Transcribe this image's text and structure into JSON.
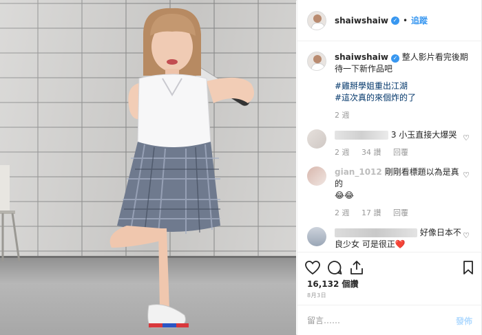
{
  "post": {
    "username": "shaiwshaiw",
    "follow_label": "追蹤",
    "separator": "•"
  },
  "caption": {
    "username": "shaiwshaiw",
    "text": "整人影片看完後期待一下新作品吧",
    "hashtags": [
      "#雞掰學姐重出江湖",
      "#這次真的來個炸的了"
    ],
    "time": "2 週"
  },
  "comments": [
    {
      "name_partial": "",
      "text": "3 小玉直接大爆哭",
      "time": "2 週",
      "likes": "34 讚",
      "reply_label": "回覆"
    },
    {
      "name_partial": "gian_1012",
      "text": "剛剛看標題以為是真的",
      "emoji": "😂😂",
      "time": "2 週",
      "likes": "17 讚",
      "reply_label": "回覆"
    },
    {
      "name_partial": "",
      "text": "好像日本不良少女 可是很正",
      "emoji": "❤️"
    }
  ],
  "engagement": {
    "likes": "16,132 個讚",
    "date": "8月3日"
  },
  "compose": {
    "placeholder": "留言……",
    "post_label": "發佈"
  },
  "colors": {
    "accent": "#3897f0",
    "muted_text": "#999999",
    "hashtag": "#003569"
  }
}
